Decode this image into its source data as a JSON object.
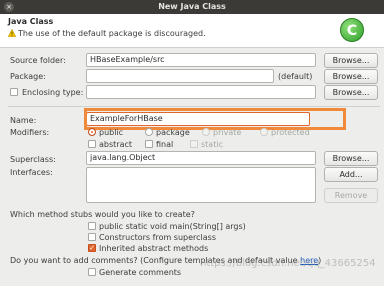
{
  "window": {
    "title": "New Java Class"
  },
  "header": {
    "title": "Java Class",
    "warning": "The use of the default package is discouraged."
  },
  "form": {
    "source_folder": {
      "label": "Source folder:",
      "value": "HBaseExample/src",
      "button": "Browse..."
    },
    "package": {
      "label": "Package:",
      "value": "",
      "hint": "(default)",
      "button": "Browse..."
    },
    "enclosing": {
      "label": "Enclosing type:",
      "value": "",
      "button": "Browse..."
    },
    "name": {
      "label": "Name:",
      "value": "ExampleForHBase"
    },
    "modifiers": {
      "label": "Modifiers:",
      "row1": [
        "public",
        "package",
        "private",
        "protected"
      ],
      "row2": [
        "abstract",
        "final",
        "static"
      ]
    },
    "superclass": {
      "label": "Superclass:",
      "value": "java.lang.Object",
      "button": "Browse..."
    },
    "interfaces": {
      "label": "Interfaces:",
      "add": "Add...",
      "remove": "Remove"
    },
    "stubs": {
      "question": "Which method stubs would you like to create?",
      "items": [
        "public static void main(String[] args)",
        "Constructors from superclass",
        "Inherited abstract methods"
      ]
    },
    "comments": {
      "question": "Do you want to add comments? (Configure templates and default value ",
      "link": "here",
      "close": ")",
      "generate": "Generate comments"
    }
  },
  "watermark": "https://blog.csdn.net/qq_43665254",
  "colors": {
    "accent": "#e2652b",
    "highlight": "#f08a3a",
    "titlebar": "#3b3a36"
  }
}
